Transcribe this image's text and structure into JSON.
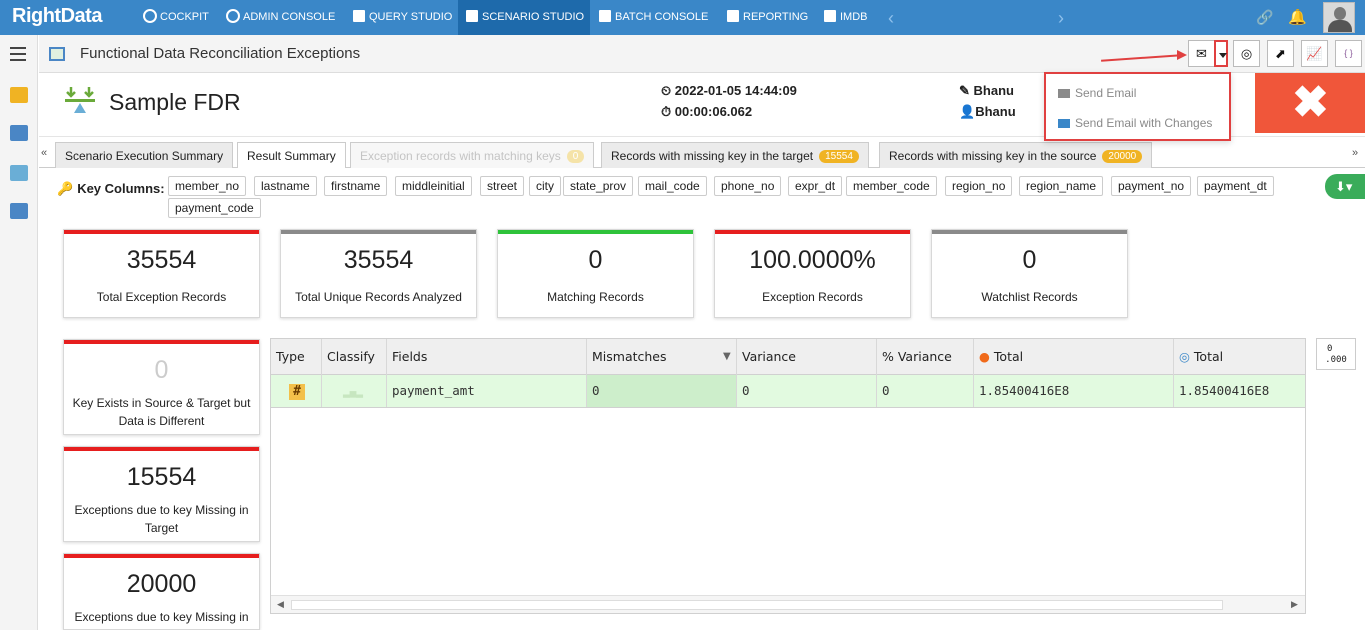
{
  "app": {
    "logo": "RightData"
  },
  "nav": {
    "items": [
      {
        "label": "COCKPIT"
      },
      {
        "label": "ADMIN CONSOLE"
      },
      {
        "label": "QUERY STUDIO"
      },
      {
        "label": "SCENARIO STUDIO",
        "active": true
      },
      {
        "label": "BATCH CONSOLE"
      },
      {
        "label": "REPORTING"
      },
      {
        "label": "IMDB"
      }
    ],
    "prev_arrow": "‹",
    "next_arrow": "›"
  },
  "page": {
    "title": "Functional Data Reconciliation Exceptions"
  },
  "scenario": {
    "name": "Sample FDR",
    "executed_at": "2022-01-05 14:44:09",
    "duration": "00:00:06.062",
    "created_by": "Bhanu",
    "modified_by": "Bhanu"
  },
  "email_menu": {
    "send_email": "Send Email",
    "send_email_changes": "Send Email with Changes"
  },
  "tabs": [
    {
      "label": "Scenario Execution Summary"
    },
    {
      "label": "Result Summary",
      "active": true
    },
    {
      "label": "Exception records with matching keys",
      "badge": "0",
      "disabled": true
    },
    {
      "label": "Records with missing key in the target",
      "badge": "15554"
    },
    {
      "label": "Records with missing key in the source",
      "badge": "20000"
    }
  ],
  "key_columns": {
    "label": "Key Columns:",
    "columns": [
      "member_no",
      "lastname",
      "firstname",
      "middleinitial",
      "street",
      "city",
      "state_prov",
      "mail_code",
      "phone_no",
      "expr_dt",
      "member_code",
      "region_no",
      "region_name",
      "payment_no",
      "payment_dt",
      "payment_code"
    ]
  },
  "stats": [
    {
      "value": "35554",
      "label": "Total Exception Records",
      "color": "#e61e1e"
    },
    {
      "value": "35554",
      "label": "Total Unique Records Analyzed",
      "color": "#8a8a8a"
    },
    {
      "value": "0",
      "label": "Matching Records",
      "color": "#2ec33a"
    },
    {
      "value": "100.0000%",
      "label": "Exception Records",
      "color": "#e61e1e"
    },
    {
      "value": "0",
      "label": "Watchlist Records",
      "color": "#8a8a8a"
    }
  ],
  "side_stats": [
    {
      "value": "0",
      "label": "Key Exists in Source & Target but Data is Different"
    },
    {
      "value": "15554",
      "label": "Exceptions due to key Missing in Target"
    },
    {
      "value": "20000",
      "label": "Exceptions due to key Missing in"
    }
  ],
  "grid": {
    "headers": [
      "Type",
      "Classify",
      "Fields",
      "Mismatches",
      "Variance",
      "% Variance",
      "Total",
      "Total"
    ],
    "rows": [
      {
        "type": "#",
        "field": "payment_amt",
        "mismatches": "0",
        "variance": "0",
        "pct_variance": "0",
        "source_total": "1.85400416E8",
        "target_total": "1.85400416E8"
      }
    ]
  },
  "decimal_toggle": {
    "line1": "0",
    "line2": ".000"
  }
}
